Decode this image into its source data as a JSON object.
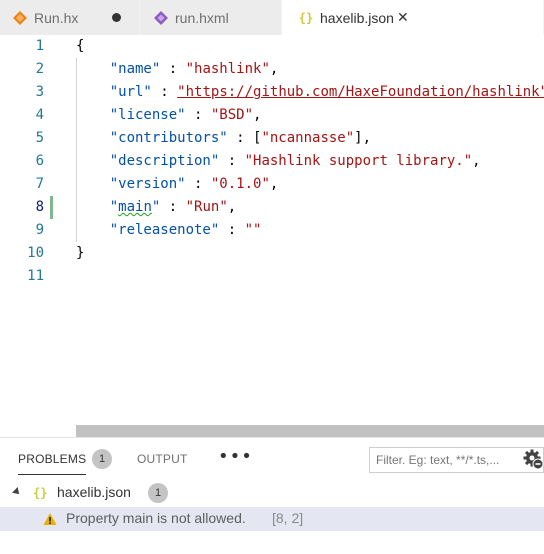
{
  "tabs": [
    {
      "label": "Run.hx",
      "icon": "haxe-file-icon",
      "status": "dirty-dot"
    },
    {
      "label": "run.hxml",
      "icon": "hxml-file-icon",
      "status": "none"
    },
    {
      "label": "haxelib.json",
      "icon": "json-braces-icon",
      "status": "close-x",
      "active": true
    }
  ],
  "editor": {
    "line_numbers": [
      "1",
      "2",
      "3",
      "4",
      "5",
      "6",
      "7",
      "8",
      "9",
      "10",
      "11"
    ],
    "current_line": "8",
    "lines": [
      {
        "open": "{"
      },
      {
        "key": "\"name\"",
        "sep": " : ",
        "value": "\"hashlink\"",
        "end": ","
      },
      {
        "key": "\"url\"",
        "sep": " : ",
        "value": "\"https://github.com/HaxeFoundation/hashlink\"",
        "end": ","
      },
      {
        "key": "\"license\"",
        "sep": " : ",
        "value": "\"BSD\"",
        "end": ","
      },
      {
        "key": "\"contributors\"",
        "sep": " : [",
        "value": "\"ncannasse\"",
        "end": "],"
      },
      {
        "key": "\"description\"",
        "sep": " : ",
        "value": "\"Hashlink support library.\"",
        "end": ","
      },
      {
        "key": "\"version\"",
        "sep": " : ",
        "value": "\"0.1.0\"",
        "end": ","
      },
      {
        "key_q1": "\"",
        "key_word": "main",
        "key_q2": "\"",
        "sep": " : ",
        "value": "\"Run\"",
        "end": ","
      },
      {
        "key": "\"releasenote\"",
        "sep": " : ",
        "value": "\"\"",
        "end": ""
      },
      {
        "close": "}"
      },
      {}
    ]
  },
  "panel": {
    "tabs": {
      "problems": "PROBLEMS",
      "problems_count": "1",
      "output": "OUTPUT",
      "more": "•••"
    },
    "filter_placeholder": "Filter. Eg: text, **/*.ts,...",
    "file": {
      "name": "haxelib.json",
      "count": "1"
    },
    "problem": {
      "message": "Property main is not allowed.",
      "location": "[8, 2]"
    }
  },
  "colors": {
    "key": "#0451a5",
    "string": "#a31515",
    "line_number": "#237893",
    "warning": "#e8b100",
    "modified_gutter": "#81b88b"
  }
}
